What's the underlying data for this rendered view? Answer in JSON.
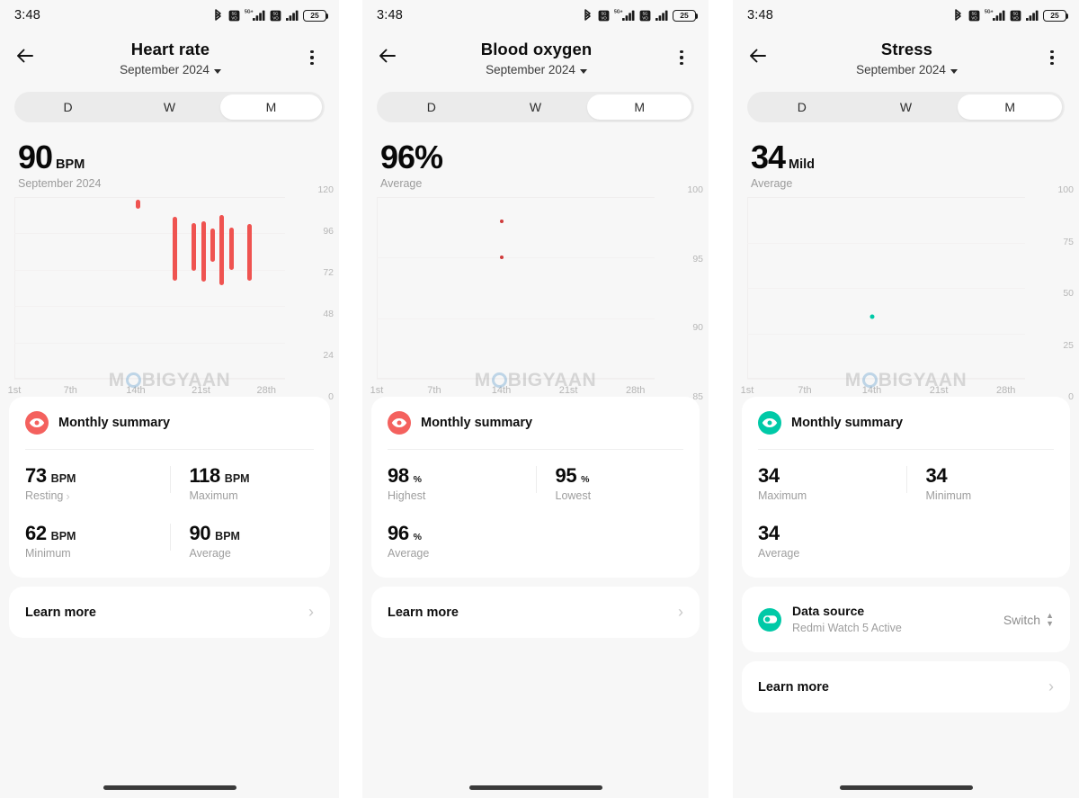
{
  "status_bar": {
    "time": "3:48",
    "battery_percent": "25",
    "icons": [
      "bluetooth-icon",
      "sim1-icon",
      "signal-5g-plus-icon",
      "sim2-icon",
      "signal-icon",
      "battery-icon"
    ]
  },
  "segments": {
    "day": "D",
    "week": "W",
    "month": "M",
    "selected": "M"
  },
  "common": {
    "month_label": "September 2024",
    "summary_title": "Monthly summary",
    "learn_more": "Learn more"
  },
  "colors": {
    "heart_accent": "#f4615e",
    "oxygen_accent": "#f4615e",
    "stress_accent": "#00c9a7",
    "bar_red": "#ef5350",
    "dot_red": "#d03c3c",
    "dot_teal": "#00c9a7"
  },
  "panels": [
    {
      "id": "heart-rate",
      "title": "Heart rate",
      "subtitle": "September 2024",
      "hero_value": "90",
      "hero_unit": "BPM",
      "hero_caption": "September 2024",
      "accent": "#f4615e",
      "stats": [
        {
          "value": "73",
          "unit": "BPM",
          "label": "Resting",
          "chevron": true
        },
        {
          "value": "118",
          "unit": "BPM",
          "label": "Maximum",
          "chevron": false
        },
        {
          "value": "62",
          "unit": "BPM",
          "label": "Minimum",
          "chevron": false
        },
        {
          "value": "90",
          "unit": "BPM",
          "label": "Average",
          "chevron": false
        }
      ],
      "has_data_source": false,
      "chart_data": {
        "type": "bar",
        "subtype": "range-bar",
        "title": "Heart rate",
        "xlabel": "",
        "ylabel": "BPM",
        "ylim": [
          0,
          120
        ],
        "yticks": [
          120,
          96,
          72,
          48,
          24,
          0
        ],
        "xticks": [
          "1st",
          "7th",
          "14th",
          "21st",
          "28th"
        ],
        "xtick_days": [
          1,
          7,
          14,
          21,
          28
        ],
        "xlim": [
          1,
          30
        ],
        "grid": true,
        "series": [
          {
            "name": "Daily heart rate range",
            "color": "#ef5350",
            "points": [
              {
                "day": 14,
                "low": 112,
                "high": 118
              },
              {
                "day": 18,
                "low": 65,
                "high": 107
              },
              {
                "day": 20,
                "low": 71,
                "high": 103
              },
              {
                "day": 21,
                "low": 64,
                "high": 104
              },
              {
                "day": 22,
                "low": 77,
                "high": 99
              },
              {
                "day": 23,
                "low": 62,
                "high": 108
              },
              {
                "day": 24,
                "low": 72,
                "high": 100
              },
              {
                "day": 26,
                "low": 65,
                "high": 102
              }
            ]
          }
        ]
      }
    },
    {
      "id": "blood-oxygen",
      "title": "Blood oxygen",
      "subtitle": "September 2024",
      "hero_value": "96%",
      "hero_unit": "",
      "hero_caption": "Average",
      "accent": "#f4615e",
      "stats": [
        {
          "value": "98",
          "unit": "%",
          "label": "Highest",
          "chevron": false
        },
        {
          "value": "95",
          "unit": "%",
          "label": "Lowest",
          "chevron": false
        },
        {
          "value": "96",
          "unit": "%",
          "label": "Average",
          "chevron": false
        }
      ],
      "has_data_source": false,
      "chart_data": {
        "type": "scatter",
        "title": "Blood oxygen",
        "xlabel": "",
        "ylabel": "%",
        "ylim": [
          85,
          100
        ],
        "yticks": [
          100,
          95,
          90,
          85
        ],
        "xticks": [
          "1st",
          "7th",
          "14th",
          "21st",
          "28th"
        ],
        "xtick_days": [
          1,
          7,
          14,
          21,
          28
        ],
        "xlim": [
          1,
          30
        ],
        "grid": true,
        "series": [
          {
            "name": "SpO2 readings",
            "color": "#d03c3c",
            "points": [
              {
                "day": 14,
                "value": 98
              },
              {
                "day": 14,
                "value": 95
              }
            ]
          }
        ]
      }
    },
    {
      "id": "stress",
      "title": "Stress",
      "subtitle": "September 2024",
      "hero_value": "34",
      "hero_unit": "Mild",
      "hero_caption": "Average",
      "accent": "#00c9a7",
      "stats": [
        {
          "value": "34",
          "unit": "",
          "label": "Maximum",
          "chevron": false
        },
        {
          "value": "34",
          "unit": "",
          "label": "Minimum",
          "chevron": false
        },
        {
          "value": "34",
          "unit": "",
          "label": "Average",
          "chevron": false
        }
      ],
      "has_data_source": true,
      "data_source": {
        "title": "Data source",
        "subtitle": "Redmi Watch 5 Active",
        "action": "Switch"
      },
      "chart_data": {
        "type": "scatter",
        "title": "Stress",
        "xlabel": "",
        "ylabel": "Stress score",
        "ylim": [
          0,
          100
        ],
        "yticks": [
          100,
          75,
          50,
          25,
          0
        ],
        "xticks": [
          "1st",
          "7th",
          "14th",
          "21st",
          "28th"
        ],
        "xtick_days": [
          1,
          7,
          14,
          21,
          28
        ],
        "xlim": [
          1,
          30
        ],
        "grid": true,
        "series": [
          {
            "name": "Stress readings",
            "color": "#00c9a7",
            "points": [
              {
                "day": 14,
                "value": 34
              }
            ]
          }
        ]
      }
    }
  ],
  "watermark": "MOBIGYAAN"
}
